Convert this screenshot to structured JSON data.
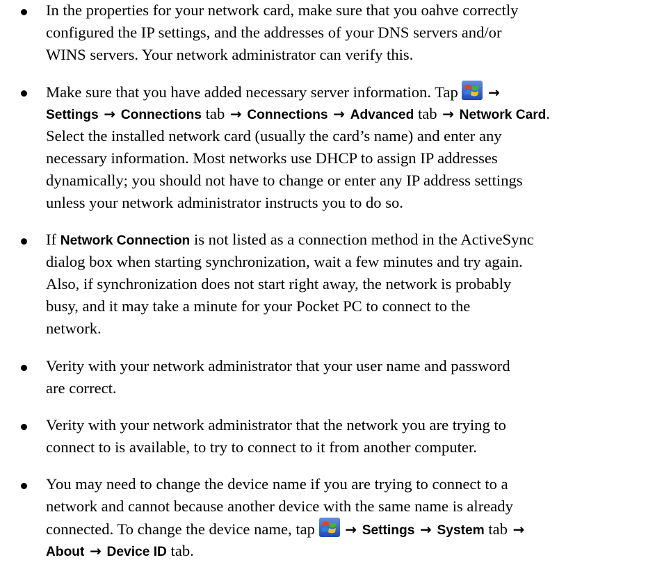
{
  "items": [
    {
      "lines": [
        "In the properties for your network card, make sure that you oahve correctly",
        "configured the IP settings, and the addresses of your DNS servers and/or",
        "WINS servers. Your network administrator can verify this."
      ]
    },
    {
      "line1_text": "Make sure that you have added necessary server information. Tap",
      "line2": {
        "settings": "Settings",
        "connections_tab_label": "Connections",
        "tab_word_1": "tab",
        "connections": "Connections",
        "advanced": "Advanced",
        "tab_word_2": "tab",
        "network_card": "Network Card",
        "period": "."
      },
      "lines_rest": [
        "Select the installed network card (usually the card’s name) and enter any",
        "necessary information. Most networks use DHCP to assign IP addresses",
        "dynamically; you should not have to change or enter any IP address settings",
        "unless your network administrator instructs you to do so."
      ]
    },
    {
      "line1_pre": "If",
      "line1_ui": "Network Connection",
      "line1_post": "is not listed as a connection method in the ActiveSync",
      "lines_rest": [
        "dialog box when starting synchronization, wait a few minutes and try again.",
        "Also, if synchronization does not start right away, the network is probably",
        "busy, and it may take a minute for your Pocket PC to connect to the",
        "network."
      ]
    },
    {
      "lines": [
        "Verity with your network administrator that your user name and password",
        "are correct."
      ]
    },
    {
      "lines": [
        "Verity with your network administrator that the network you are trying to",
        "connect to is available, to try to connect to it from another computer."
      ]
    },
    {
      "lines": [
        "You may need to change the device name if you are trying to connect to a",
        "network and cannot because another device with the same name is already"
      ],
      "line3_text": "connected. To change the device name, tap",
      "line3": {
        "settings": "Settings",
        "system": "System",
        "tab_word": "tab"
      },
      "line4": {
        "about": "About",
        "device_id": "Device ID",
        "tab_word": "tab."
      }
    }
  ],
  "arrow_glyph": "→",
  "icons": {
    "start_menu": "windows-start-icon",
    "bullet": "bullet-dot"
  }
}
